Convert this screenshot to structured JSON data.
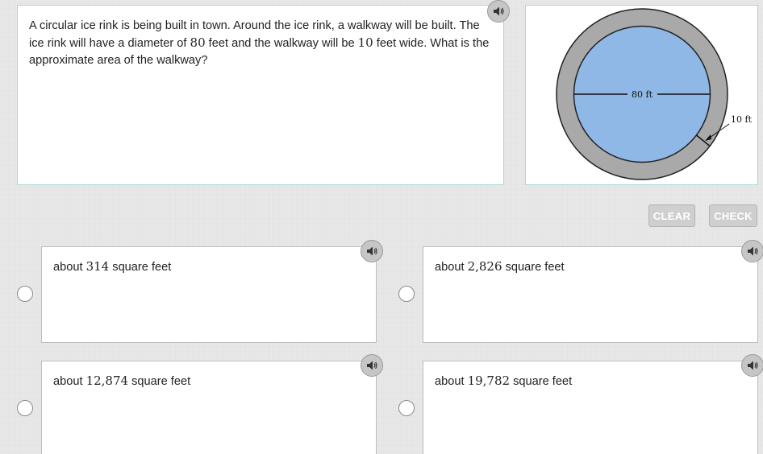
{
  "question": {
    "text_parts": [
      "A circular ice rink is being built in town. Around the ice rink, a walkway will be built. The ice rink will have a diameter of ",
      "80",
      " feet and the walkway will be ",
      "10",
      " feet wide. What is the approximate area of the walkway?"
    ]
  },
  "figure": {
    "diameter_label": "80 ft",
    "width_label": "10 ft",
    "rink_color": "#8fb8e6",
    "walkway_color": "#a9a9a9"
  },
  "actions": {
    "clear_label": "CLEAR",
    "check_label": "CHECK"
  },
  "choices": [
    {
      "prefix": "about ",
      "number": "314",
      "suffix": " square feet"
    },
    {
      "prefix": "about ",
      "number": "2,826",
      "suffix": " square feet"
    },
    {
      "prefix": "about ",
      "number": "12,874",
      "suffix": " square feet"
    },
    {
      "prefix": "about ",
      "number": "19,782",
      "suffix": " square feet"
    }
  ],
  "icons": {
    "audio": "speaker-icon"
  }
}
